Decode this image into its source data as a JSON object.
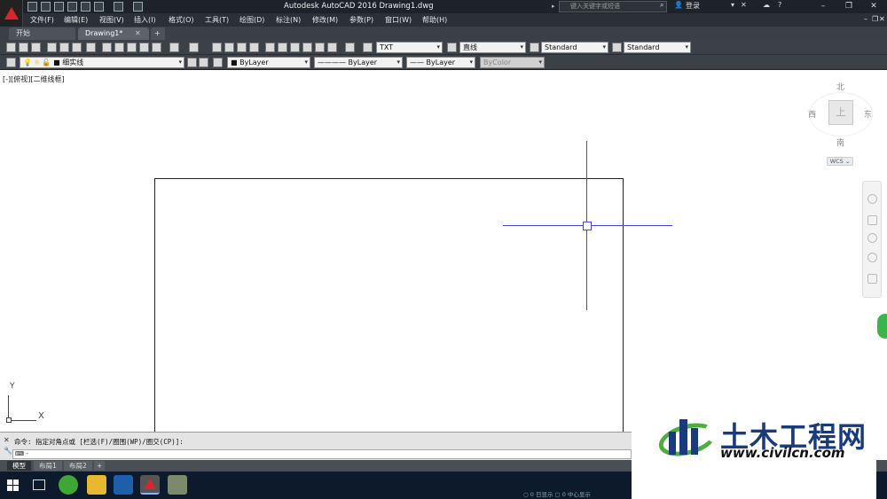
{
  "window": {
    "title": "Autodesk AutoCAD 2016    Drawing1.dwg",
    "search_placeholder": "键入关键字或短语",
    "login_label": "登录",
    "min_icon": "minimize-icon",
    "max_icon": "maximize-icon",
    "close_icon": "close-icon"
  },
  "menu": [
    "文件(F)",
    "编辑(E)",
    "视图(V)",
    "插入(I)",
    "格式(O)",
    "工具(T)",
    "绘图(D)",
    "标注(N)",
    "修改(M)",
    "参数(P)",
    "窗口(W)",
    "帮助(H)"
  ],
  "tabs": [
    {
      "label": "开始",
      "active": false
    },
    {
      "label": "Drawing1*",
      "active": true
    },
    {
      "label": "+",
      "active": false
    }
  ],
  "toolbar": {
    "text_style": "TXT",
    "dim_style": "直线",
    "table_style": "Standard",
    "multileader_style": "Standard",
    "layer": "■ 细实线",
    "color": "■ ByLayer",
    "linetype": "———— ByLayer",
    "lineweight": "—— ByLayer",
    "plotstyle": "ByColor"
  },
  "viewport": {
    "label": "[-][俯视][二维线框]"
  },
  "viewcube": {
    "north": "北",
    "south": "南",
    "east": "东",
    "west": "西",
    "top": "上",
    "wcs": "WCS ⌄"
  },
  "ucs": {
    "x": "X",
    "y": "Y"
  },
  "command": {
    "history": "命令: 指定对角点或 [栏选(F)/圈围(WP)/圈交(CP)]:",
    "prompt": "⌨ -"
  },
  "layout_tabs": [
    "模型",
    "布局1",
    "布局2",
    "+"
  ],
  "status": {
    "text": "○ 0 日显示      ▢ 0 中心显示"
  },
  "watermark": {
    "title": "土木工程网",
    "url": "www.civilcn.com"
  },
  "colors": {
    "crosshair": "#3b4bd8",
    "accent_red": "#d8262c",
    "watermark_blue": "#1a3a7e",
    "watermark_green": "#4caf3c"
  }
}
